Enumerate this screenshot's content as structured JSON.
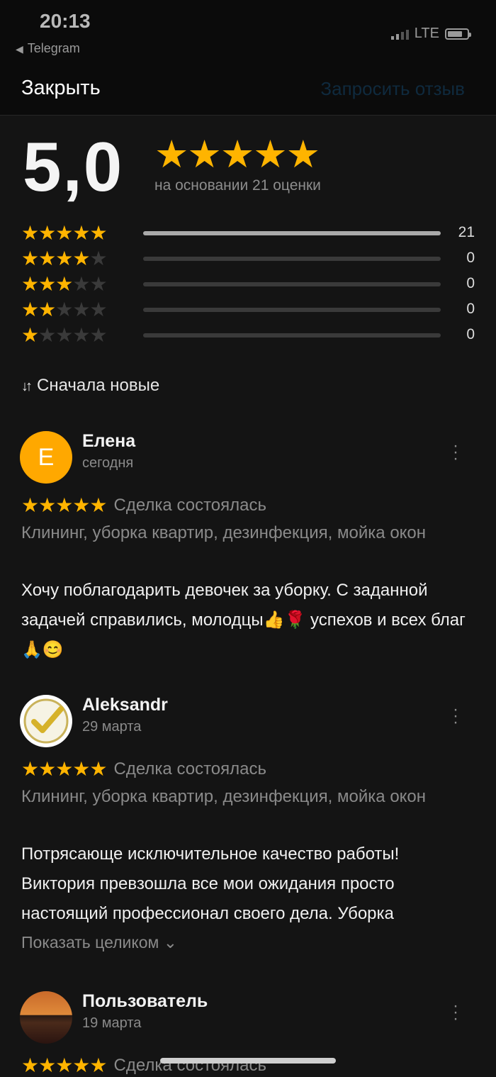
{
  "status_bar": {
    "time": "20:13",
    "back_app": "Telegram",
    "network": "LTE"
  },
  "nav": {
    "close_label": "Закрыть",
    "request_label": "Запросить отзыв"
  },
  "summary": {
    "score": "5,0",
    "stars": "★★★★★",
    "based_on": "на основании 21 оценки",
    "breakdown": [
      {
        "stars": 5,
        "count": "21",
        "fraction": 1.0
      },
      {
        "stars": 4,
        "count": "0",
        "fraction": 0
      },
      {
        "stars": 3,
        "count": "0",
        "fraction": 0
      },
      {
        "stars": 2,
        "count": "0",
        "fraction": 0
      },
      {
        "stars": 1,
        "count": "0",
        "fraction": 0
      }
    ]
  },
  "sort": {
    "icon": "sort-arrows-icon",
    "label": "Сначала новые"
  },
  "reviews": [
    {
      "avatar_letter": "Е",
      "name": "Елена",
      "date": "сегодня",
      "stars": "★★★★★",
      "deal": "Сделка состоялась",
      "category": "Клининг, уборка квартир, дезинфекция, мойка окон",
      "text": "Хочу поблагодарить девочек за уборку. С заданной задачей  справились, молодцы👍🌹 успехов и всех благ 🙏😊"
    },
    {
      "avatar_icon": "checkmark-icon",
      "name": "Aleksandr",
      "date": "29 марта",
      "stars": "★★★★★",
      "deal": "Сделка состоялась",
      "category": "Клининг, уборка квартир, дезинфекция, мойка окон",
      "text": "Потрясающе исключительное качество работы! Виктория превзошла все мои ожидания  просто настоящий профессионал своего дела. Уборка",
      "show_more": "Показать целиком ⌄"
    },
    {
      "avatar_icon": "sunset-photo",
      "name": "Пользователь",
      "date": "19 марта",
      "stars": "★★★★★",
      "deal": "Сделка состоялась"
    }
  ],
  "colors": {
    "star": "#ffb400",
    "background": "#141414",
    "avatar_e": "#ffa800"
  }
}
